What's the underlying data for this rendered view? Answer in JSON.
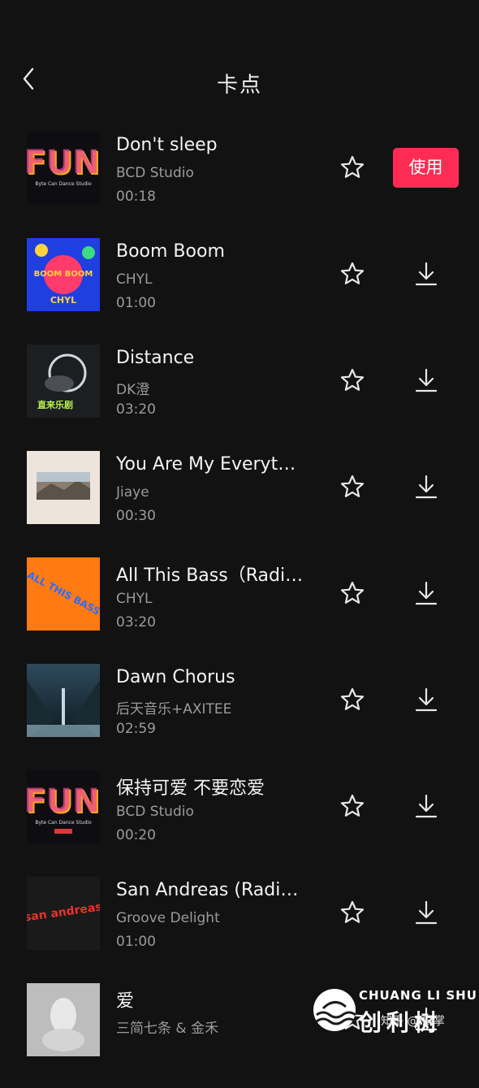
{
  "header": {
    "title": "卡点"
  },
  "accent_color": "#fe2c55",
  "songs": [
    {
      "title": "Don't sleep",
      "artist": "BCD Studio",
      "duration": "00:18",
      "action": "使用",
      "cover_text": "FUN",
      "cover_sub": "Byte Can Dance Studio"
    },
    {
      "title": "Boom Boom",
      "artist": "CHYL",
      "duration": "01:00",
      "cover_text": "BOOM BOOM",
      "cover_sub": "CHYL"
    },
    {
      "title": "Distance",
      "artist": "DK澄",
      "duration": "03:20",
      "cover_text": "直来乐剧"
    },
    {
      "title": "You Are My Everythin...",
      "artist": "Jiaye",
      "duration": "00:30"
    },
    {
      "title": "All This Bass（Radio...",
      "artist": "CHYL",
      "duration": "03:20",
      "cover_text": "ALL THIS BASS"
    },
    {
      "title": "Dawn Chorus",
      "artist": "后天音乐+AXITEE",
      "duration": "02:59"
    },
    {
      "title": "保持可爱 不要恋爱",
      "artist": "BCD Studio",
      "duration": "00:20",
      "cover_text": "FUN",
      "cover_sub": "Byte Can Dance Studio"
    },
    {
      "title": "San Andreas (Radio...",
      "artist": "Groove Delight",
      "duration": "01:00",
      "cover_text": "san andreas"
    },
    {
      "title": "爱",
      "artist": "三简七条 & 金禾",
      "duration": ""
    }
  ],
  "watermark": {
    "top": "CHUANG LI SHU",
    "big": "创利树",
    "small": "知乎 @ 辰掌"
  }
}
